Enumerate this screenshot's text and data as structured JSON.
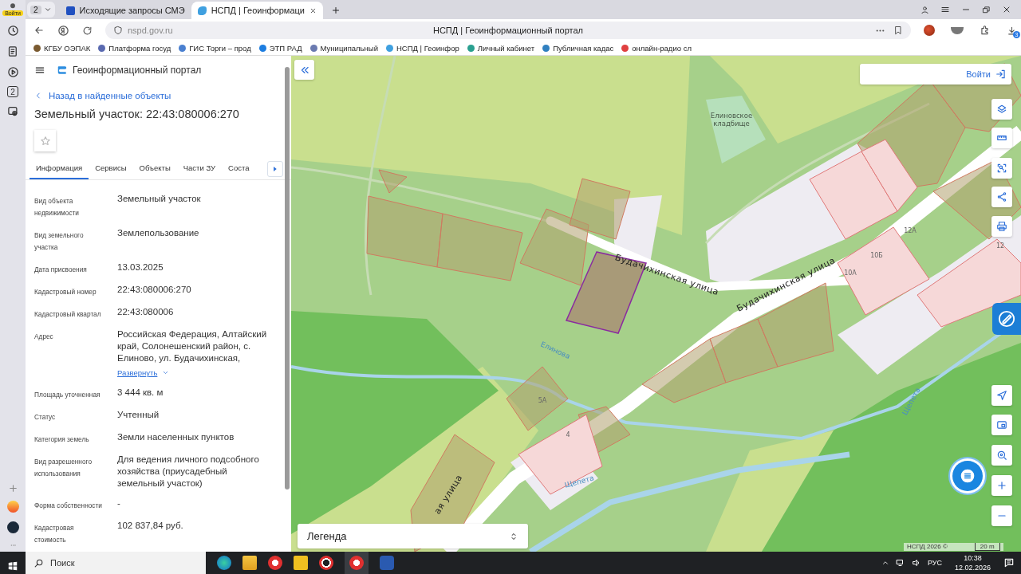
{
  "side_panel": {
    "profile_label": "Войти",
    "counter": "2"
  },
  "browser": {
    "tab_count": "2",
    "tabs": [
      {
        "title": "Исходящие запросы СМЭ",
        "selected": false
      },
      {
        "title": "НСПД | Геоинформаци",
        "selected": true
      }
    ],
    "address": "nspd.gov.ru",
    "page_title": "НСПД | Геоинформационный портал",
    "download_badge": "3",
    "bookmarks": [
      "КГБУ ОЭПАК",
      "Платформа госуд",
      "ГИС Торги – прод",
      "ЭТП РАД",
      "Муниципальный",
      "НСПД | Геоинфор",
      "Личный кабинет",
      "Публичная кадас",
      "онлайн-радио сл"
    ]
  },
  "portal": {
    "title": "Геоинформационный портал",
    "back_link": "Назад в найденные объекты",
    "heading": "Земельный участок: 22:43:080006:270",
    "tabs": [
      {
        "label": "Информация",
        "selected": true
      },
      {
        "label": "Сервисы",
        "selected": false
      },
      {
        "label": "Объекты",
        "selected": false
      },
      {
        "label": "Части ЗУ",
        "selected": false
      },
      {
        "label": "Соста",
        "selected": false
      }
    ],
    "fields": [
      {
        "label": "Вид объекта недвижимости",
        "value": "Земельный участок"
      },
      {
        "label": "Вид земельного участка",
        "value": "Землепользование"
      },
      {
        "label": "Дата присвоения",
        "value": "13.03.2025"
      },
      {
        "label": "Кадастровый номер",
        "value": "22:43:080006:270"
      },
      {
        "label": "Кадастровый квартал",
        "value": "22:43:080006"
      },
      {
        "label": "Адрес",
        "value": "Российская Федерация, Алтайский край, Солонешенский район, с. Елиново, ул. Будачихинская,",
        "more": "Развернуть"
      },
      {
        "label": "Площадь уточненная",
        "value": "3 444 кв. м"
      },
      {
        "label": "Статус",
        "value": "Учтенный"
      },
      {
        "label": "Категория земель",
        "value": "Земли населенных пунктов"
      },
      {
        "label": "Вид разрешенного использования",
        "value": "Для ведения личного подсобного хозяйства (приусадебный земельный участок)"
      },
      {
        "label": "Форма собственности",
        "value": "-"
      },
      {
        "label": "Кадастровая стоимость",
        "value": "102 837,84 руб."
      }
    ]
  },
  "map": {
    "login": "Войти",
    "cemetery_label": [
      "Елиновское",
      "кладбище"
    ],
    "labels": [
      {
        "kind": "street",
        "text": "Будачихинская улица"
      },
      {
        "kind": "street",
        "text": "Будачихинская улица"
      },
      {
        "kind": "street",
        "text": "ая улица"
      },
      {
        "kind": "river",
        "text": "Елинова"
      },
      {
        "kind": "river",
        "text": "Щепета"
      },
      {
        "kind": "river",
        "text": "Щепета"
      },
      {
        "kind": "house",
        "text": "12А"
      },
      {
        "kind": "house",
        "text": "12"
      },
      {
        "kind": "house",
        "text": "10Б"
      },
      {
        "kind": "house",
        "text": "10А"
      },
      {
        "kind": "house",
        "text": "5А"
      },
      {
        "kind": "house",
        "text": "4"
      }
    ],
    "legend": "Легенда",
    "attribution": "НСПД 2026 ©",
    "scale": "20 m"
  },
  "taskbar": {
    "search": "Поиск",
    "language": "РУС",
    "time": "10:38",
    "date": "12.02.2026"
  }
}
